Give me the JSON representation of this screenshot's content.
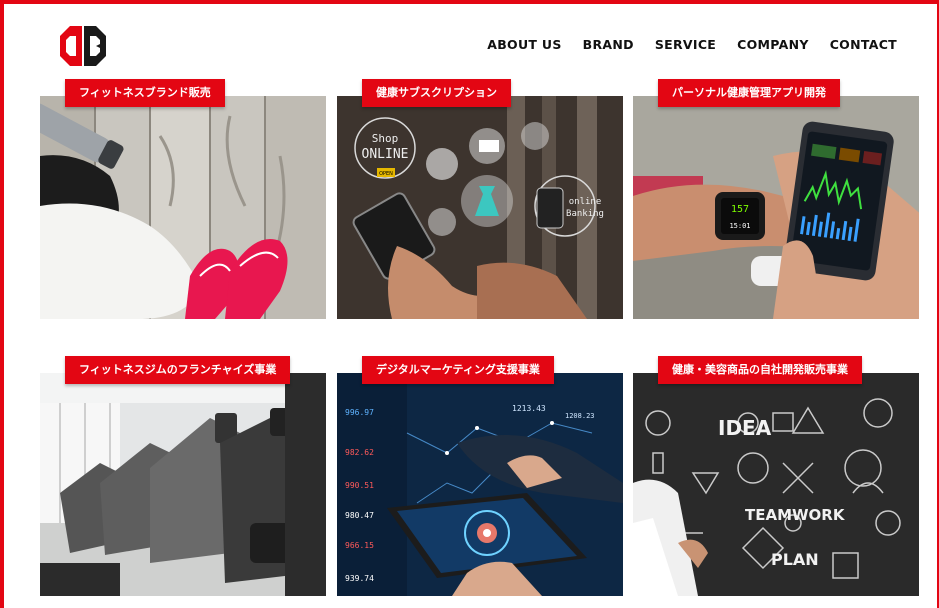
{
  "brand": {
    "logo_icon": "db-monogram-logo",
    "accent": "#e30613"
  },
  "nav": {
    "items": [
      "ABOUT US",
      "BRAND",
      "SERVICE",
      "COMPANY",
      "CONTACT"
    ]
  },
  "cards": [
    {
      "title": "フィットネスブランド販売"
    },
    {
      "title": "健康サブスクリプション"
    },
    {
      "title": "パーソナル健康管理アプリ開発"
    },
    {
      "title": "フィットネスジムのフランチャイズ事業"
    },
    {
      "title": "デジタルマーケティング支援事業"
    },
    {
      "title": "健康・美容商品の自社開発販売事業"
    }
  ],
  "photo_text": {
    "shop": "Shop",
    "online": "ONLINE",
    "open": "OPEN",
    "banking1": "online",
    "banking2": "Banking",
    "watch1": "157",
    "watch2": "15:01",
    "idea": "IDEA",
    "teamwork": "TEAMWORK",
    "plan": "PLAN",
    "tickers": [
      "996.97",
      "982.62",
      "990.51",
      "980.47",
      "966.15",
      "939.74",
      "1213.43",
      "1208.23"
    ]
  }
}
